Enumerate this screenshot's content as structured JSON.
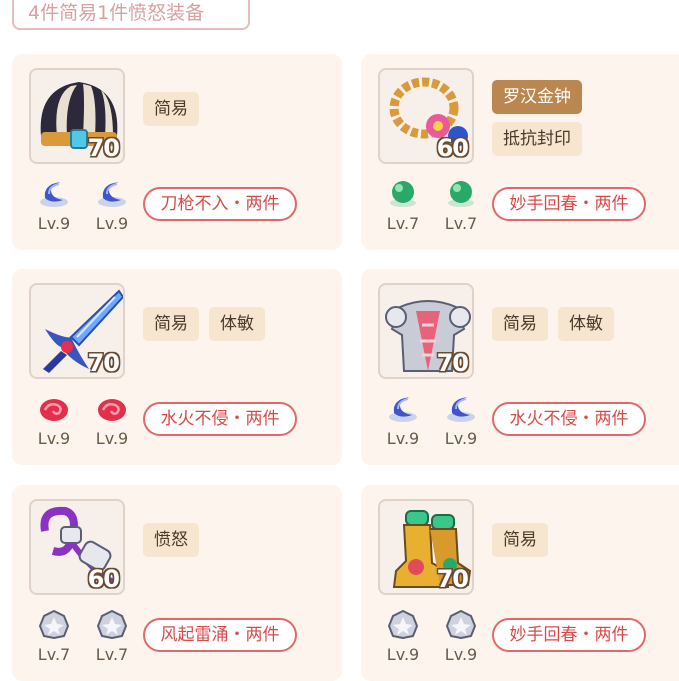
{
  "header": {
    "title": "4件简易1件愤怒装备"
  },
  "items": [
    {
      "icon": "striped-helmet-icon",
      "level": "70",
      "tags": [
        "简易"
      ],
      "gem_icon": "blue-moon-gem-icon",
      "gems": [
        "Lv.9",
        "Lv.9"
      ],
      "set": "刀枪不入・两件"
    },
    {
      "icon": "prayer-beads-necklace-icon",
      "level": "60",
      "tags": [
        "罗汉金钟",
        "抵抗封印"
      ],
      "gem_icon": "green-orb-gem-icon",
      "gems": [
        "Lv.7",
        "Lv.7"
      ],
      "set": "妙手回春・两件"
    },
    {
      "icon": "blue-sword-icon",
      "level": "70",
      "tags": [
        "简易",
        "体敏"
      ],
      "gem_icon": "red-swirl-gem-icon",
      "gems": [
        "Lv.9",
        "Lv.9"
      ],
      "set": "水火不侵・两件"
    },
    {
      "icon": "silver-armor-icon",
      "level": "70",
      "tags": [
        "简易",
        "体敏"
      ],
      "gem_icon": "blue-moon-gem-icon",
      "gems": [
        "Lv.9",
        "Lv.9"
      ],
      "set": "水火不侵・两件"
    },
    {
      "icon": "purple-belt-icon",
      "level": "60",
      "tags": [
        "愤怒"
      ],
      "gem_icon": "silver-star-gem-icon",
      "gems": [
        "Lv.7",
        "Lv.7"
      ],
      "set": "风起雷涌・两件"
    },
    {
      "icon": "green-boots-icon",
      "level": "70",
      "tags": [
        "简易"
      ],
      "gem_icon": "silver-star-gem-icon",
      "gems": [
        "Lv.9",
        "Lv.9"
      ],
      "set": "妙手回春・两件"
    }
  ],
  "colors": {
    "card_bg": "#fdf4ee",
    "tag_bg": "#f6e5cf",
    "special_tag_bg": "#b9874f",
    "set_border": "#e16868"
  }
}
